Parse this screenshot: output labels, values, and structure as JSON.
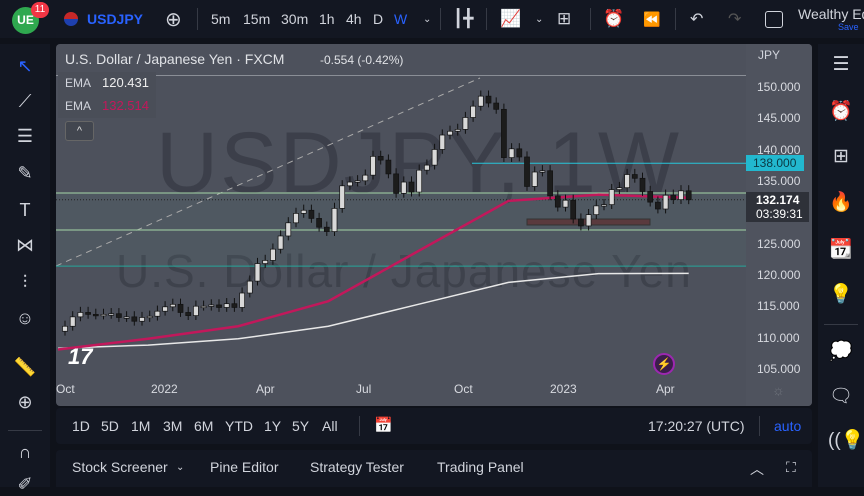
{
  "topbar": {
    "notif_count": "11",
    "symbol": "USDJPY",
    "intervals": [
      "5m",
      "15m",
      "30m",
      "1h",
      "4h",
      "D",
      "W"
    ],
    "active_interval": "W",
    "layout_name": "Wealthy Ed",
    "save": "Save"
  },
  "legend": {
    "title": "U.S. Dollar / Japanese Yen · FXCM",
    "change": "-0.554 (-0.42%)",
    "ema1_label": "EMA",
    "ema1_value": "120.431",
    "ema2_label": "EMA",
    "ema2_value": "132.514"
  },
  "watermark": {
    "line1": "USDJPY, 1W",
    "line2": "U.S. Dollar / Japanese Yen"
  },
  "price_axis": {
    "currency": "JPY",
    "ticks": [
      "150.000",
      "145.000",
      "140.000",
      "135.000",
      "125.000",
      "120.000",
      "115.000",
      "110.000",
      "105.000"
    ],
    "level_label": "138.000",
    "last_price": "132.174",
    "countdown": "03:39:31"
  },
  "time_axis": [
    "Oct",
    "2022",
    "Apr",
    "Jul",
    "Oct",
    "2023",
    "Apr"
  ],
  "ranges": [
    "1D",
    "5D",
    "1M",
    "3M",
    "6M",
    "YTD",
    "1Y",
    "5Y",
    "All"
  ],
  "clock": "17:20:27 (UTC)",
  "auto": "auto",
  "bottom_tabs": [
    "Stock Screener",
    "Pine Editor",
    "Strategy Tester",
    "Trading Panel"
  ],
  "colors": {
    "accent": "#2962ff",
    "ema_fast": "#c2185b",
    "ema_slow": "#e0e0e0",
    "level": "#26c6da",
    "zone": "#a5d6a7"
  },
  "chart_data": {
    "type": "candlestick",
    "timeframe": "1W",
    "ylim": [
      103,
      153
    ],
    "closes": [
      112,
      113.5,
      114.2,
      113.9,
      113.8,
      113.9,
      114.0,
      113.4,
      113.5,
      112.8,
      113.4,
      113.6,
      114.4,
      115.1,
      115.5,
      114.2,
      113.7,
      115.2,
      115.2,
      115.4,
      115.0,
      115.6,
      115.0,
      117.3,
      119.2,
      122.0,
      122.5,
      124.3,
      126.4,
      128.5,
      130.0,
      130.5,
      129.2,
      127.8,
      127.1,
      130.8,
      134.4,
      135.0,
      135.2,
      136.1,
      139.1,
      138.5,
      136.3,
      133.2,
      135.0,
      133.4,
      136.9,
      137.7,
      140.2,
      142.5,
      143.1,
      143.4,
      145.3,
      147.1,
      148.7,
      147.6,
      146.6,
      138.9,
      140.3,
      139.0,
      134.3,
      136.6,
      136.8,
      132.8,
      131.0,
      132.1,
      129.1,
      128.0,
      129.8,
      131.2,
      131.4,
      133.8,
      134.1,
      136.2,
      135.6,
      133.5,
      131.8,
      130.7,
      132.9,
      132.2,
      133.6,
      132.174
    ],
    "ema_fast": [
      108.3,
      110,
      112,
      116,
      124,
      132,
      133,
      132.5
    ],
    "ema_slow": [
      108.5,
      109,
      110,
      112,
      115.5,
      119,
      120.4,
      120.431
    ],
    "levels": [
      138.0,
      133.25,
      127.35,
      121.6,
      152.0
    ]
  }
}
